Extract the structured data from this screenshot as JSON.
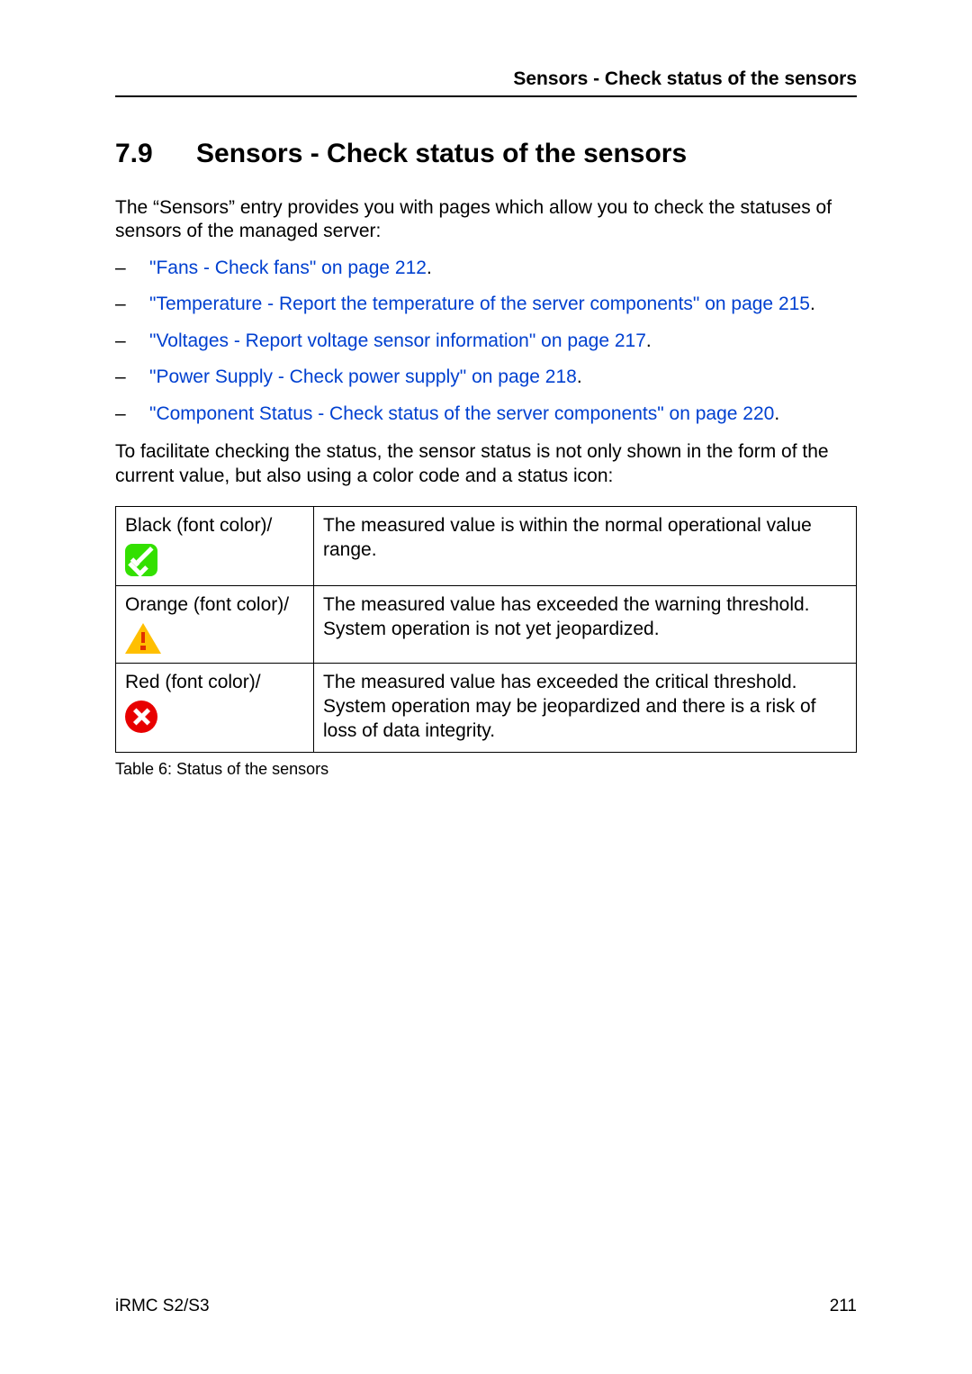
{
  "header": {
    "running": "Sensors - Check status of the sensors"
  },
  "heading": {
    "number": "7.9",
    "title": "Sensors - Check status of the sensors"
  },
  "intro": "The “Sensors” entry provides you with pages which allow you to check the statuses of sensors of the managed server:",
  "links": [
    "\"Fans - Check fans\" on page 212",
    "\"Temperature - Report the temperature of the server components\" on page 215",
    "\"Voltages - Report voltage sensor information\" on page 217",
    "\"Power Supply - Check power supply\" on page 218",
    "\"Component Status - Check status of the server components\" on page 220"
  ],
  "para2": "To facilitate checking the status, the sensor status is not only shown in the form of the current value, but also using a color code and a status icon:",
  "table": {
    "rows": [
      {
        "label": "Black (font color)/",
        "desc": "The measured value is within the normal operational value range."
      },
      {
        "label": "Orange (font color)/",
        "desc": "The measured value has exceeded the warning threshold.\nSystem operation is not yet jeopardized."
      },
      {
        "label": "Red (font color)/",
        "desc": "The measured value has exceeded the critical threshold.\nSystem operation may be jeopardized and there is a risk of loss of data integrity."
      }
    ],
    "caption": "Table 6: Status of the sensors"
  },
  "footer": {
    "left": "iRMC S2/S3",
    "right": "211"
  }
}
